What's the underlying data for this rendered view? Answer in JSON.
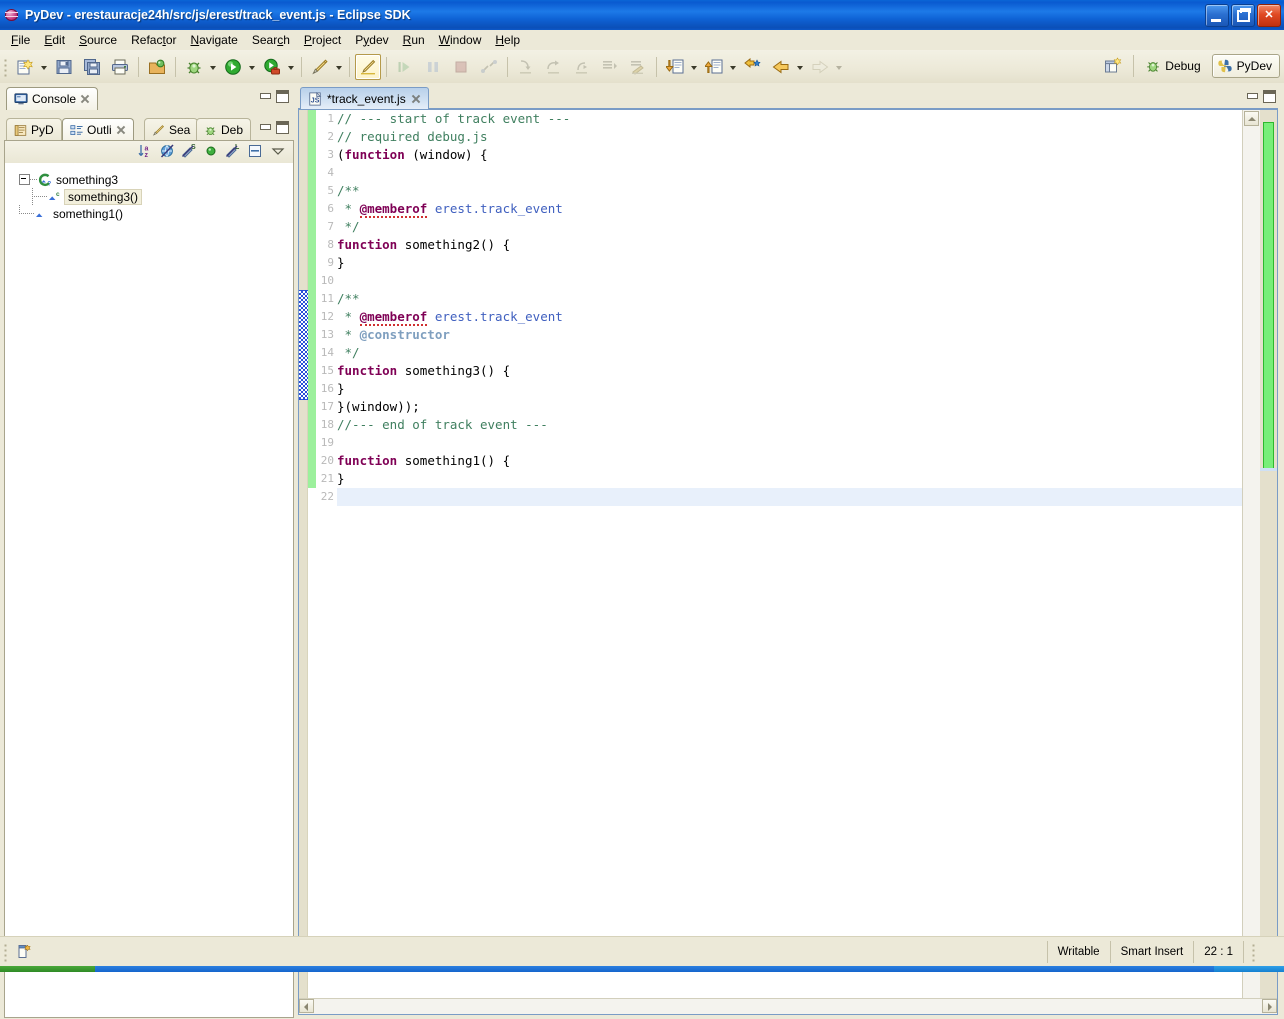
{
  "window": {
    "title": "PyDev - erestauracje24h/src/js/erest/track_event.js - Eclipse SDK",
    "app_icon": "eclipse-globe-icon",
    "controls": {
      "minimize": "minimize-button",
      "restore": "restore-button",
      "close": "close-button"
    }
  },
  "menu": [
    {
      "label": "File",
      "mnemonic": "F"
    },
    {
      "label": "Edit",
      "mnemonic": "E"
    },
    {
      "label": "Source",
      "mnemonic": "S"
    },
    {
      "label": "Refactor",
      "mnemonic": "t"
    },
    {
      "label": "Navigate",
      "mnemonic": "N"
    },
    {
      "label": "Search",
      "mnemonic": "c"
    },
    {
      "label": "Project",
      "mnemonic": "P"
    },
    {
      "label": "Pydev",
      "mnemonic": "y"
    },
    {
      "label": "Run",
      "mnemonic": "R"
    },
    {
      "label": "Window",
      "mnemonic": "W"
    },
    {
      "label": "Help",
      "mnemonic": "H"
    }
  ],
  "toolbar": {
    "groups": [
      [
        "new-wizard-icon",
        "new-wizard-dropdown",
        "save-icon",
        "save-all-icon",
        "print-icon"
      ],
      [
        "open-type-icon"
      ],
      [
        "debug-icon",
        "debug-dropdown",
        "run-icon",
        "run-dropdown",
        "external-tools-icon",
        "external-tools-dropdown"
      ],
      [
        "annotate-icon",
        "annotate-dropdown"
      ],
      [
        "toggle-mark-occurrences-icon"
      ],
      [
        "resume-icon",
        "suspend-icon",
        "terminate-icon",
        "disconnect-icon"
      ],
      [
        "step-into-icon",
        "step-over-icon",
        "step-return-icon",
        "drop-to-frame-icon",
        "use-step-filters-icon"
      ],
      [
        "next-annotation-icon",
        "next-annotation-dropdown",
        "previous-annotation-icon",
        "previous-annotation-dropdown",
        "last-edit-location-icon",
        "back-icon",
        "back-dropdown",
        "forward-icon",
        "forward-dropdown"
      ]
    ],
    "perspective": {
      "open_perspective_icon": "open-perspective-icon",
      "items": [
        {
          "label": "Debug",
          "icon": "debug-perspective-icon",
          "active": false
        },
        {
          "label": "PyDev",
          "icon": "pydev-perspective-icon",
          "active": true
        }
      ]
    }
  },
  "left_panel": {
    "console_stack": {
      "tabs": [
        {
          "label": "Console",
          "icon": "console-icon",
          "selected": true,
          "closable": true
        }
      ]
    },
    "outline_stack": {
      "tabs": [
        {
          "label": "PyD",
          "icon": "pydev-package-explorer-icon",
          "selected": false,
          "closable": false
        },
        {
          "label": "Outli",
          "icon": "outline-icon",
          "selected": true,
          "closable": true
        },
        {
          "label": "Sea",
          "icon": "search-icon",
          "selected": false,
          "closable": false
        },
        {
          "label": "Deb",
          "icon": "debug-view-icon",
          "selected": false,
          "closable": false
        }
      ],
      "view_toolbar": [
        "sort-alphabetically-icon",
        "hide-non-public-members-icon",
        "hide-static-members-icon",
        "filter-green-dot-icon",
        "hide-local-types-icon",
        "collapse-all-icon",
        "view-menu-icon"
      ],
      "tree": [
        {
          "label": "something3",
          "icon": "js-object-icon",
          "expanded": true,
          "selected": false,
          "depth": 0
        },
        {
          "label": "something3()",
          "icon": "js-constructor-icon",
          "expanded": false,
          "selected": true,
          "depth": 1
        },
        {
          "label": "something1()",
          "icon": "js-function-icon",
          "expanded": false,
          "selected": false,
          "depth": 0
        }
      ]
    }
  },
  "editor": {
    "tab": {
      "label": "*track_event.js",
      "icon": "js-file-icon",
      "dirty": true,
      "closable": true,
      "selected": true
    },
    "lines": [
      {
        "n": 1,
        "changed": true,
        "selected": false,
        "current": false,
        "tokens": [
          {
            "t": "// --- start of track event ---",
            "c": "cmt"
          }
        ]
      },
      {
        "n": 2,
        "changed": true,
        "selected": false,
        "current": false,
        "tokens": [
          {
            "t": "// required debug.js",
            "c": "cmt"
          }
        ]
      },
      {
        "n": 3,
        "changed": true,
        "selected": false,
        "current": false,
        "tokens": [
          {
            "t": "(",
            "c": ""
          },
          {
            "t": "function",
            "c": "kw"
          },
          {
            "t": " (window) {",
            "c": ""
          }
        ]
      },
      {
        "n": 4,
        "changed": true,
        "selected": false,
        "current": false,
        "tokens": []
      },
      {
        "n": 5,
        "changed": true,
        "selected": false,
        "current": false,
        "tokens": [
          {
            "t": "/**",
            "c": "cmt"
          }
        ]
      },
      {
        "n": 6,
        "changed": true,
        "selected": false,
        "current": false,
        "tokens": [
          {
            "t": " * ",
            "c": "cmt"
          },
          {
            "t": "@memberof",
            "c": "kw err"
          },
          {
            "t": " erest.track_event",
            "c": "doc"
          }
        ]
      },
      {
        "n": 7,
        "changed": true,
        "selected": false,
        "current": false,
        "tokens": [
          {
            "t": " */",
            "c": "cmt"
          }
        ]
      },
      {
        "n": 8,
        "changed": true,
        "selected": false,
        "current": false,
        "tokens": [
          {
            "t": "function",
            "c": "kw"
          },
          {
            "t": " something2() {",
            "c": ""
          }
        ]
      },
      {
        "n": 9,
        "changed": true,
        "selected": false,
        "current": false,
        "tokens": [
          {
            "t": "}",
            "c": ""
          }
        ]
      },
      {
        "n": 10,
        "changed": true,
        "selected": false,
        "current": false,
        "tokens": []
      },
      {
        "n": 11,
        "changed": true,
        "selected": true,
        "current": false,
        "tokens": [
          {
            "t": "/**",
            "c": "cmt"
          }
        ]
      },
      {
        "n": 12,
        "changed": true,
        "selected": true,
        "current": false,
        "tokens": [
          {
            "t": " * ",
            "c": "cmt"
          },
          {
            "t": "@memberof",
            "c": "kw err"
          },
          {
            "t": " erest.track_event",
            "c": "doc"
          }
        ]
      },
      {
        "n": 13,
        "changed": true,
        "selected": true,
        "current": false,
        "tokens": [
          {
            "t": " * ",
            "c": "cmt"
          },
          {
            "t": "@constructor",
            "c": "tag"
          }
        ]
      },
      {
        "n": 14,
        "changed": true,
        "selected": true,
        "current": false,
        "tokens": [
          {
            "t": " */",
            "c": "cmt"
          }
        ]
      },
      {
        "n": 15,
        "changed": true,
        "selected": true,
        "current": false,
        "tokens": [
          {
            "t": "function",
            "c": "kw"
          },
          {
            "t": " something3() {",
            "c": ""
          }
        ]
      },
      {
        "n": 16,
        "changed": true,
        "selected": true,
        "current": false,
        "tokens": [
          {
            "t": "}",
            "c": ""
          }
        ]
      },
      {
        "n": 17,
        "changed": true,
        "selected": false,
        "current": false,
        "tokens": [
          {
            "t": "}(window));",
            "c": ""
          }
        ]
      },
      {
        "n": 18,
        "changed": true,
        "selected": false,
        "current": false,
        "tokens": [
          {
            "t": "//--- end of track event ---",
            "c": "cmt"
          }
        ]
      },
      {
        "n": 19,
        "changed": true,
        "selected": false,
        "current": false,
        "tokens": []
      },
      {
        "n": 20,
        "changed": true,
        "selected": false,
        "current": false,
        "tokens": [
          {
            "t": "function",
            "c": "kw"
          },
          {
            "t": " something1() {",
            "c": ""
          }
        ]
      },
      {
        "n": 21,
        "changed": true,
        "selected": false,
        "current": false,
        "tokens": [
          {
            "t": "}",
            "c": ""
          }
        ]
      },
      {
        "n": 22,
        "changed": false,
        "selected": false,
        "current": true,
        "tokens": []
      }
    ],
    "scrollbar": {
      "up_button": "scroll-up-button",
      "down_button": "scroll-down-button",
      "left_button": "scroll-left-button",
      "right_button": "scroll-right-button"
    },
    "overview_ruler": {
      "change_mark_color": "#78ee78",
      "cursor_mark_color": "#cfe0f4"
    }
  },
  "status_bar": {
    "left_icon": "editor-status-icon",
    "cells": [
      {
        "label": "Writable",
        "name": "writable-status"
      },
      {
        "label": "Smart Insert",
        "name": "insert-mode-status"
      },
      {
        "label": "22 : 1",
        "name": "cursor-position-status"
      }
    ]
  },
  "colors": {
    "title_blue": "#0f63d6",
    "chrome": "#ece9d8",
    "change_bar": "#9cf09c",
    "selection_marker": "#2a4fd8",
    "current_line": "#e8f0fb",
    "comment": "#3f7f5f",
    "keyword": "#7f0055",
    "doc_text": "#3f5fbf",
    "doc_tag": "#7f9fbf",
    "line_number": "#b9b9b9"
  }
}
